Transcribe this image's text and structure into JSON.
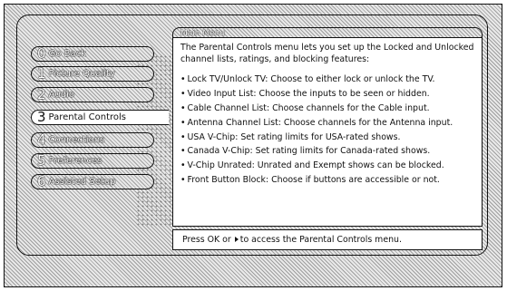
{
  "title_tab": "Main Menu",
  "menu": [
    {
      "number": "0",
      "label": "Go Back"
    },
    {
      "number": "1",
      "label": "Picture Quality"
    },
    {
      "number": "2",
      "label": "Audio"
    },
    {
      "number": "3",
      "label": "Parental Controls",
      "selected": true
    },
    {
      "number": "4",
      "label": "Connections"
    },
    {
      "number": "5",
      "label": "Preferences"
    },
    {
      "number": "6",
      "label": "Assisted Setup"
    }
  ],
  "content": {
    "intro": "The Parental Controls menu lets you set up the Locked and Unlocked channel lists, ratings, and blocking features:",
    "bullets": [
      "Lock TV/Unlock TV: Choose to either lock or unlock the TV.",
      "Video Input List: Choose the inputs to be seen or hidden.",
      "Cable Channel List: Choose channels for the Cable input.",
      "Antenna Channel List: Choose channels for the Antenna input.",
      "USA V-Chip: Set rating limits for USA-rated shows.",
      "Canada V-Chip: Set rating limits for Canada-rated shows.",
      "V-Chip Unrated: Unrated and Exempt shows can be blocked.",
      "Front Button Block: Choose if buttons are accessible or not."
    ]
  },
  "footer": {
    "prefix": "Press OK or",
    "suffix": "to access the Parental Controls menu."
  }
}
